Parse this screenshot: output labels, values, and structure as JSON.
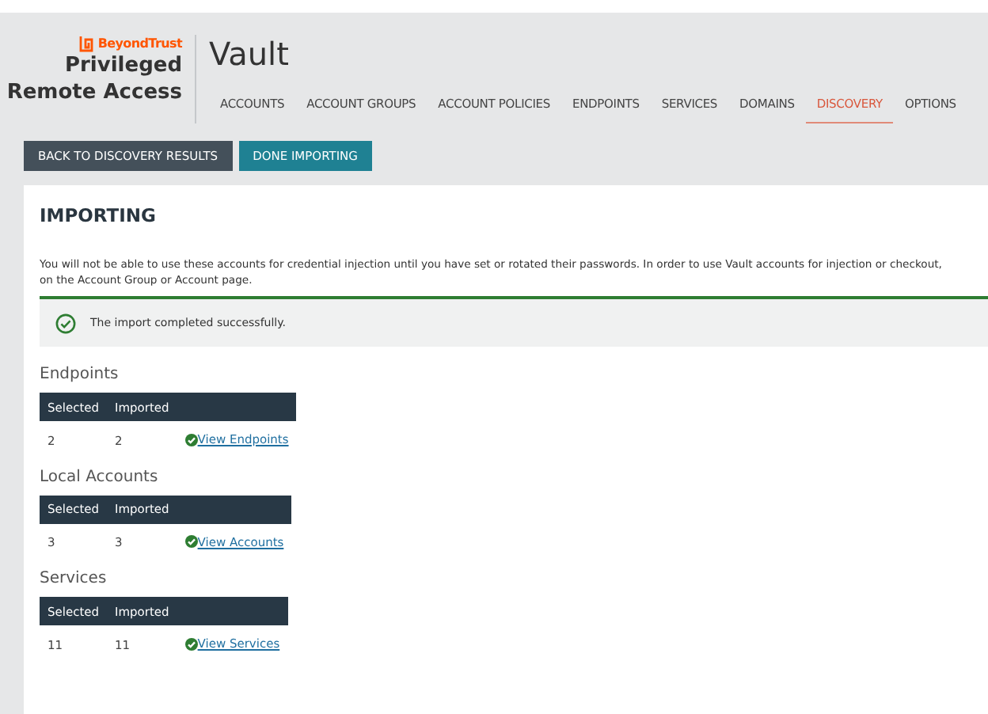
{
  "logo": {
    "brand": "BeyondTrust",
    "product_line_1": "Privileged",
    "product_line_2": "Remote Access"
  },
  "page_title": "Vault",
  "tabs": [
    {
      "label": "ACCOUNTS",
      "selected": false
    },
    {
      "label": "ACCOUNT GROUPS",
      "selected": false
    },
    {
      "label": "ACCOUNT POLICIES",
      "selected": false
    },
    {
      "label": "ENDPOINTS",
      "selected": false
    },
    {
      "label": "SERVICES",
      "selected": false
    },
    {
      "label": "DOMAINS",
      "selected": false
    },
    {
      "label": "DISCOVERY",
      "selected": true
    },
    {
      "label": "OPTIONS",
      "selected": false
    }
  ],
  "buttons": [
    {
      "label": "BACK TO DISCOVERY RESULTS",
      "kind": "dark"
    },
    {
      "label": "DONE IMPORTING",
      "kind": "teal"
    }
  ],
  "panel": {
    "title": "IMPORTING",
    "notice_lines": [
      "You will not be able to use these accounts for credential injection until you have set or rotated their passwords. In order to use Vault accounts for injection or checkout,",
      "on the Account Group or Account page."
    ],
    "success_message": "The import completed successfully.",
    "sections": [
      {
        "heading": "Endpoints",
        "columns": [
          "Selected",
          "Imported"
        ],
        "selected": "2",
        "imported": "2",
        "link": "View Endpoints"
      },
      {
        "heading": "Local Accounts",
        "columns": [
          "Selected",
          "Imported"
        ],
        "selected": "3",
        "imported": "3",
        "link": "View Accounts"
      },
      {
        "heading": "Services",
        "columns": [
          "Selected",
          "Imported"
        ],
        "selected": "11",
        "imported": "11",
        "link": "View Services"
      }
    ]
  }
}
